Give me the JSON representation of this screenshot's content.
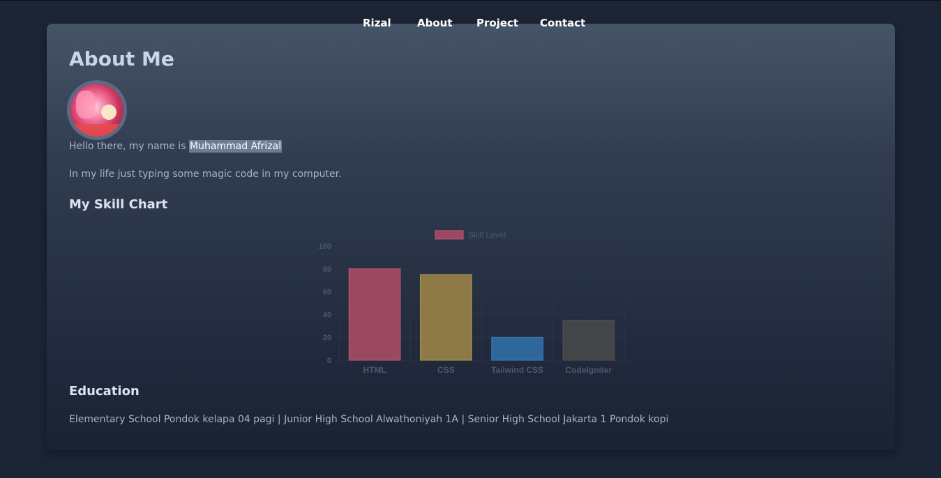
{
  "nav": {
    "brand": "Rizal",
    "about": "About",
    "project": "Project",
    "contact": "Contact"
  },
  "about": {
    "title": "About Me",
    "intro_prefix": "Hello there, my name is ",
    "name": "Muhammad Afrizal",
    "life": "In my life just typing some magic code in my computer."
  },
  "skills": {
    "heading": "My Skill Chart"
  },
  "education": {
    "heading": "Education",
    "text": "Elementary School Pondok kelapa 04 pagi | Junior High School Alwathoniyah 1A | Senior High School Jakarta 1 Pondok kopi"
  },
  "chart_data": {
    "type": "bar",
    "categories": [
      "HTML",
      "CSS",
      "Tailwind CSS",
      "CodeIgniter"
    ],
    "series": [
      {
        "name": "Skill Level",
        "values": [
          80,
          75,
          20,
          35
        ]
      }
    ],
    "colors": [
      "#9b4863",
      "#8e7a47",
      "#2e6799",
      "#444549"
    ],
    "border_colors": [
      "#c8567a",
      "#b59a51",
      "#3b83c0",
      "#505155"
    ],
    "legend_color": "#9b4863",
    "y_ticks": [
      0,
      20,
      40,
      60,
      80,
      100
    ],
    "ylim": [
      0,
      100
    ],
    "legend_position": "top",
    "grid": true
  }
}
